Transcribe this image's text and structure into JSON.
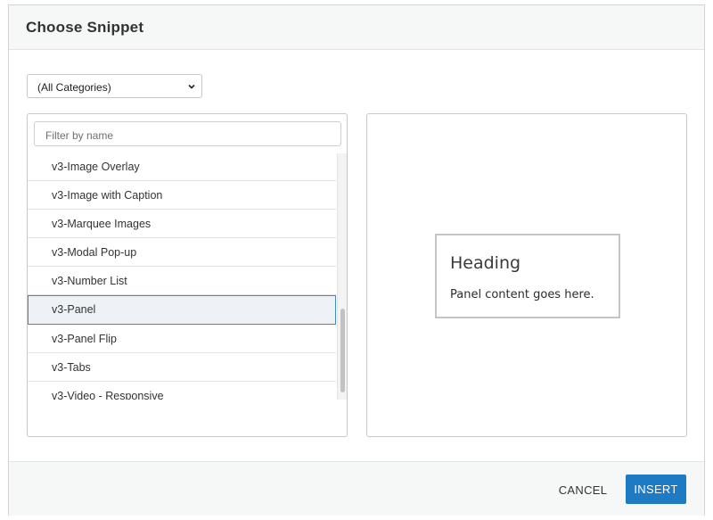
{
  "dialog": {
    "title": "Choose Snippet"
  },
  "category_select": {
    "value": "(All Categories)",
    "icon": "chevron-down-icon"
  },
  "filter": {
    "placeholder": "Filter by name"
  },
  "snippets": {
    "items": [
      {
        "label": "v3-Image Overlay",
        "selected": false
      },
      {
        "label": "v3-Image with Caption",
        "selected": false
      },
      {
        "label": "v3-Marquee Images",
        "selected": false
      },
      {
        "label": "v3-Modal Pop-up",
        "selected": false
      },
      {
        "label": "v3-Number List",
        "selected": false
      },
      {
        "label": "v3-Panel",
        "selected": true
      },
      {
        "label": "v3-Panel Flip",
        "selected": false
      },
      {
        "label": "v3-Tabs",
        "selected": false
      },
      {
        "label": "v3-Video - Responsive",
        "selected": false
      }
    ]
  },
  "preview": {
    "heading": "Heading",
    "body": "Panel content goes here."
  },
  "footer": {
    "cancel_label": "CANCEL",
    "insert_label": "INSERT"
  },
  "colors": {
    "accent": "#1f7ac4",
    "selected_row_bg": "#eef2f6",
    "selected_row_border": "#3f8bc4"
  }
}
